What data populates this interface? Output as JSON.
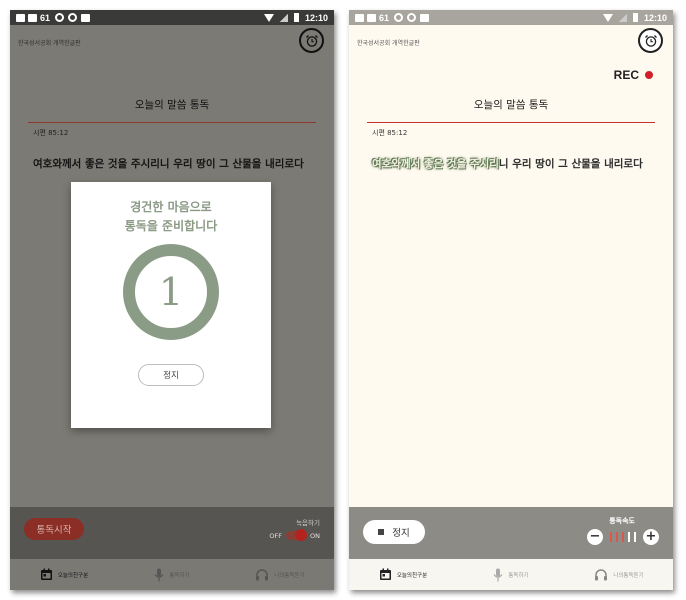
{
  "status_bar": {
    "notification_count": "61",
    "time": "12:10"
  },
  "app": {
    "name": "한국성서공회 개역한글판"
  },
  "reading": {
    "title": "오늘의 말씀 통독",
    "verse_ref": "시편 85:12",
    "passage_left": "여호와께서 좋은 것을 주시리니 우리 땅이 그 산물을 내리로다",
    "passage_highlight": "여호와께서 좋은 것을 주시리",
    "passage_rest": "니 우리 땅이 그 산물을 내리로다"
  },
  "modal": {
    "line1": "경건한 마음으로",
    "line2": "통독을 준비합니다",
    "countdown": "1",
    "stop_label": "정지"
  },
  "left_controls": {
    "start_label": "통독시작",
    "record_label": "녹음하기",
    "off_label": "OFF",
    "on_label": "ON",
    "record_enabled": true
  },
  "right_controls": {
    "rec_label": "REC",
    "stop_label": "정지",
    "speed_label": "통독속도",
    "speed_level": 3,
    "speed_levels": 5
  },
  "tabs": [
    {
      "label": "오늘의친구분",
      "icon": "calendar-icon",
      "active": true
    },
    {
      "label": "통독하기",
      "icon": "microphone-icon",
      "active": false
    },
    {
      "label": "나의통독듣기",
      "icon": "headphones-icon",
      "active": false
    }
  ],
  "colors": {
    "accent_red": "#c7302d",
    "sage_green": "#8a9b86",
    "rec_dot": "#d0202a"
  }
}
